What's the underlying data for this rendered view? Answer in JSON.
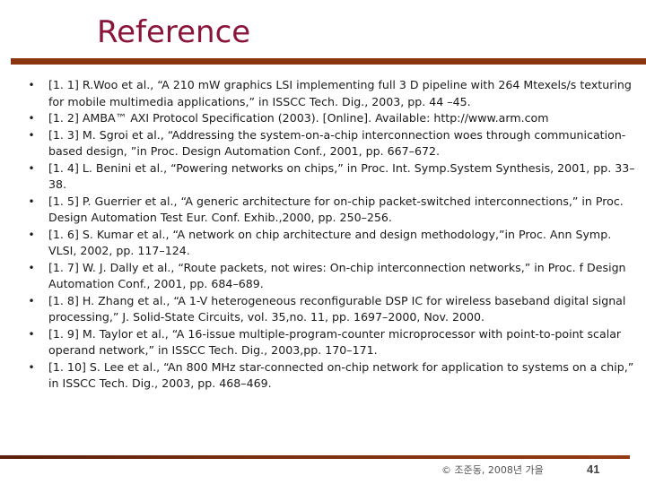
{
  "slide": {
    "title": "Reference",
    "colors": {
      "title": "#8a1538",
      "top_rule": "#8a3410",
      "bottom_rule_start": "#5a1e0a",
      "bottom_rule_end": "#933a12"
    }
  },
  "references": [
    {
      "bullet": "•",
      "text": "[1. 1] R.Woo et al., “A 210 mW graphics LSI implementing full 3 D pipeline with 264 Mtexels/s texturing for mobile multimedia applications,” in ISSCC Tech. Dig., 2003, pp. 44 –45."
    },
    {
      "bullet": "•",
      "text": "[1. 2] AMBA™ AXI Protocol Specification (2003). [Online]. Available: http://www.arm.com"
    },
    {
      "bullet": "•",
      "text": "[1. 3] M. Sgroi et al., “Addressing the system-on-a-chip interconnection woes through communication-based design, ”in Proc. Design Automation Conf., 2001, pp. 667–672."
    },
    {
      "bullet": "•",
      "text": "[1. 4] L. Benini et al., “Powering networks on chips,” in Proc. Int. Symp.System Synthesis, 2001, pp. 33–38."
    },
    {
      "bullet": "•",
      "text": "[1. 5] P. Guerrier et al., “A generic architecture for on-chip packet-switched interconnections,” in Proc. Design Automation Test Eur. Conf. Exhib.,2000, pp. 250–256."
    },
    {
      "bullet": "•",
      "text": "[1. 6] S. Kumar et al., “A network on chip architecture and design methodology,”in Proc. Ann Symp. VLSI, 2002, pp. 117–124."
    },
    {
      "bullet": "•",
      "text": "[1. 7] W. J. Dally et al., “Route packets, not wires: On-chip interconnection networks,” in Proc. f Design Automation Conf., 2001, pp. 684–689."
    },
    {
      "bullet": "•",
      "text": "[1. 8] H. Zhang et al., “A 1-V heterogeneous reconfigurable DSP IC for wireless baseband digital signal processing,” J. Solid-State Circuits, vol. 35,no. 11, pp. 1697–2000, Nov. 2000."
    },
    {
      "bullet": "•",
      "text": "[1. 9] M. Taylor et al., “A 16-issue multiple-program-counter microprocessor with point-to-point scalar operand network,” in ISSCC Tech. Dig., 2003,pp. 170–171."
    },
    {
      "bullet": "•",
      "text": "[1. 10] S. Lee et al., “An 800 MHz star-connected on-chip network for application to systems on a chip,” in ISSCC Tech. Dig., 2003, pp. 468–469."
    }
  ],
  "footer": {
    "copyright": "© 조준동, 2008년 가을",
    "page_number": "41"
  }
}
